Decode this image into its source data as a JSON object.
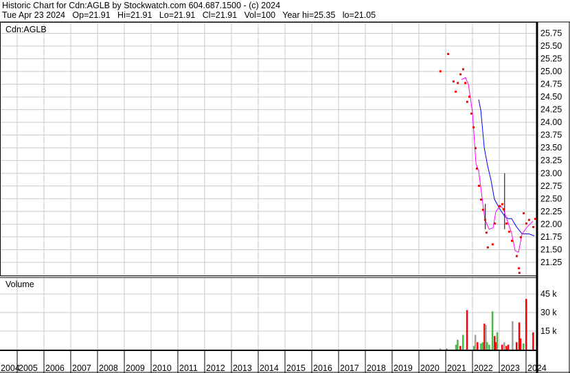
{
  "header": {
    "line1": "Historic Chart for Cdn:AGLB by Stockwatch.com 604.687.1500 - (c) 2024",
    "line2": "Tue Apr 23 2024   Op=21.91   Hi=21.91   Lo=21.91   Cl=21.91   Vol=100   Year hi=25.35   lo=21.05"
  },
  "chart_data": [
    {
      "type": "line",
      "title": "Cdn:AGLB",
      "ylim": [
        21.0,
        25.9
      ],
      "xlim": [
        2004,
        2024.4
      ],
      "yticks": [
        "25.75",
        "25.50",
        "25.25",
        "25.00",
        "24.75",
        "24.50",
        "24.25",
        "24.00",
        "23.75",
        "23.50",
        "23.25",
        "23.00",
        "22.75",
        "22.50",
        "22.25",
        "22.00",
        "21.75",
        "21.50",
        "21.25"
      ],
      "xticks": [
        "2004",
        "2005",
        "2006",
        "2007",
        "2008",
        "2009",
        "2010",
        "2011",
        "2012",
        "2013",
        "2014",
        "2015",
        "2016",
        "2017",
        "2018",
        "2019",
        "2020",
        "2021",
        "2022",
        "2023",
        "2024"
      ],
      "grid": true,
      "colors": {
        "price": "#ff0000",
        "ma_short": "#ff00ff",
        "ma_long": "#0000ff",
        "spike": "#000000"
      },
      "price_points": [
        [
          2020.79,
          25.01
        ],
        [
          2021.08,
          25.35
        ],
        [
          2021.28,
          24.81
        ],
        [
          2021.36,
          24.61
        ],
        [
          2021.44,
          24.78
        ],
        [
          2021.54,
          24.95
        ],
        [
          2021.64,
          25.05
        ],
        [
          2021.72,
          24.78
        ],
        [
          2021.79,
          24.41
        ],
        [
          2021.87,
          24.51
        ],
        [
          2021.95,
          24.18
        ],
        [
          2022.03,
          23.91
        ],
        [
          2022.1,
          23.5
        ],
        [
          2022.15,
          23.1
        ],
        [
          2022.23,
          22.76
        ],
        [
          2022.31,
          22.49
        ],
        [
          2022.38,
          22.29
        ],
        [
          2022.46,
          22.09
        ],
        [
          2022.51,
          21.84
        ],
        [
          2022.56,
          21.55
        ],
        [
          2022.74,
          21.61
        ],
        [
          2022.82,
          22.02
        ],
        [
          2023.0,
          22.36
        ],
        [
          2023.1,
          22.4
        ],
        [
          2023.15,
          22.3
        ],
        [
          2023.26,
          22.02
        ],
        [
          2023.36,
          21.86
        ],
        [
          2023.46,
          21.68
        ],
        [
          2023.64,
          21.38
        ],
        [
          2023.72,
          21.14
        ],
        [
          2023.74,
          21.05
        ],
        [
          2023.79,
          21.75
        ],
        [
          2023.9,
          22.22
        ],
        [
          2024.0,
          22.02
        ],
        [
          2024.1,
          22.09
        ],
        [
          2024.26,
          21.95
        ],
        [
          2024.33,
          22.11
        ]
      ],
      "spikes": [
        [
          2022.48,
          21.9,
          22.4
        ],
        [
          2023.2,
          21.9,
          23.0
        ]
      ],
      "ma_short": [
        [
          2021.59,
          24.84
        ],
        [
          2021.74,
          24.88
        ],
        [
          2021.85,
          24.74
        ],
        [
          2022.0,
          24.2
        ],
        [
          2022.13,
          23.19
        ],
        [
          2022.23,
          23.05
        ],
        [
          2022.36,
          22.51
        ],
        [
          2022.46,
          22.1
        ],
        [
          2022.62,
          21.9
        ],
        [
          2022.77,
          21.93
        ],
        [
          2022.87,
          22.24
        ],
        [
          2023.03,
          22.37
        ],
        [
          2023.15,
          22.3
        ],
        [
          2023.28,
          22.1
        ],
        [
          2023.46,
          21.83
        ],
        [
          2023.59,
          21.48
        ],
        [
          2023.72,
          21.45
        ],
        [
          2023.85,
          21.81
        ],
        [
          2024.05,
          21.95
        ],
        [
          2024.26,
          22.06
        ]
      ],
      "ma_long": [
        [
          2022.23,
          24.45
        ],
        [
          2022.31,
          24.24
        ],
        [
          2022.44,
          23.5
        ],
        [
          2022.56,
          23.16
        ],
        [
          2022.69,
          22.87
        ],
        [
          2022.82,
          22.49
        ],
        [
          2023.03,
          22.29
        ],
        [
          2023.21,
          22.15
        ],
        [
          2023.33,
          22.11
        ],
        [
          2023.46,
          22.11
        ],
        [
          2023.64,
          21.95
        ],
        [
          2023.85,
          21.81
        ],
        [
          2024.1,
          21.81
        ],
        [
          2024.31,
          21.77
        ]
      ]
    },
    {
      "type": "bar",
      "title": "Volume",
      "ylim": [
        0,
        52
      ],
      "yticks": [
        "45 k",
        "30 k",
        "15 k"
      ],
      "ytick_values": [
        45,
        30,
        15
      ],
      "unit": "thousand shares",
      "bars": [
        [
          2020.79,
          1,
          "#a0a0a0"
        ],
        [
          2021.03,
          1,
          "#4cb848"
        ],
        [
          2021.38,
          4,
          "#4cb848"
        ],
        [
          2021.44,
          8,
          "#4cb848"
        ],
        [
          2021.54,
          3,
          "#ff0000"
        ],
        [
          2021.64,
          12,
          "#4cb848"
        ],
        [
          2021.79,
          32,
          "#ff0000"
        ],
        [
          2022.05,
          3,
          "#4cb848"
        ],
        [
          2022.1,
          12,
          "#a0a0a0"
        ],
        [
          2022.18,
          6,
          "#ff0000"
        ],
        [
          2022.31,
          5,
          "#4cb848"
        ],
        [
          2022.38,
          6,
          "#4cb848"
        ],
        [
          2022.44,
          21,
          "#ff0000"
        ],
        [
          2022.49,
          20,
          "#a0a0a0"
        ],
        [
          2022.54,
          6,
          "#4cb848"
        ],
        [
          2022.62,
          4,
          "#4cb848"
        ],
        [
          2022.74,
          31,
          "#4cb848"
        ],
        [
          2022.82,
          11,
          "#ff0000"
        ],
        [
          2022.87,
          6,
          "#ff0000"
        ],
        [
          2022.92,
          14,
          "#4cb848"
        ],
        [
          2023.1,
          4,
          "#ff0000"
        ],
        [
          2023.18,
          6,
          "#a0a0a0"
        ],
        [
          2023.26,
          3,
          "#ff0000"
        ],
        [
          2023.33,
          4,
          "#ff0000"
        ],
        [
          2023.49,
          23,
          "#a0a0a0"
        ],
        [
          2023.64,
          6,
          "#ff0000"
        ],
        [
          2023.74,
          22,
          "#ff0000"
        ],
        [
          2023.79,
          9,
          "#ff0000"
        ],
        [
          2023.9,
          5,
          "#4cb848"
        ],
        [
          2024.0,
          41,
          "#ff0000"
        ],
        [
          2024.26,
          14,
          "#ff0000"
        ]
      ]
    }
  ]
}
